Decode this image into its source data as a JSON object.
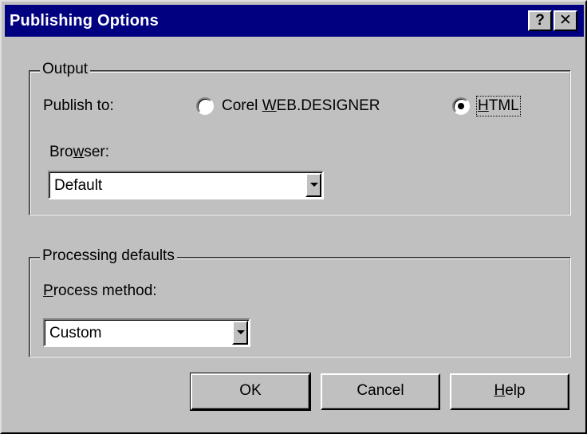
{
  "window": {
    "title": "Publishing Options",
    "help_button": "?",
    "close_button": "✕"
  },
  "output_group": {
    "legend": "Output",
    "publish_to_label": "Publish to:",
    "radio_web": {
      "prefix": "Corel ",
      "mnemonic": "W",
      "suffix": "EB.DESIGNER",
      "selected": false
    },
    "radio_html": {
      "mnemonic": "H",
      "suffix": "TML",
      "selected": true
    },
    "browser_label": {
      "prefix": "Bro",
      "mnemonic": "w",
      "suffix": "ser:"
    },
    "browser_value": "Default"
  },
  "processing_group": {
    "legend": "Processing defaults",
    "method_label": {
      "mnemonic": "P",
      "suffix": "rocess method:"
    },
    "method_value": "Custom"
  },
  "buttons": {
    "ok": "OK",
    "cancel": "Cancel",
    "help": {
      "mnemonic": "H",
      "suffix": "elp"
    }
  }
}
